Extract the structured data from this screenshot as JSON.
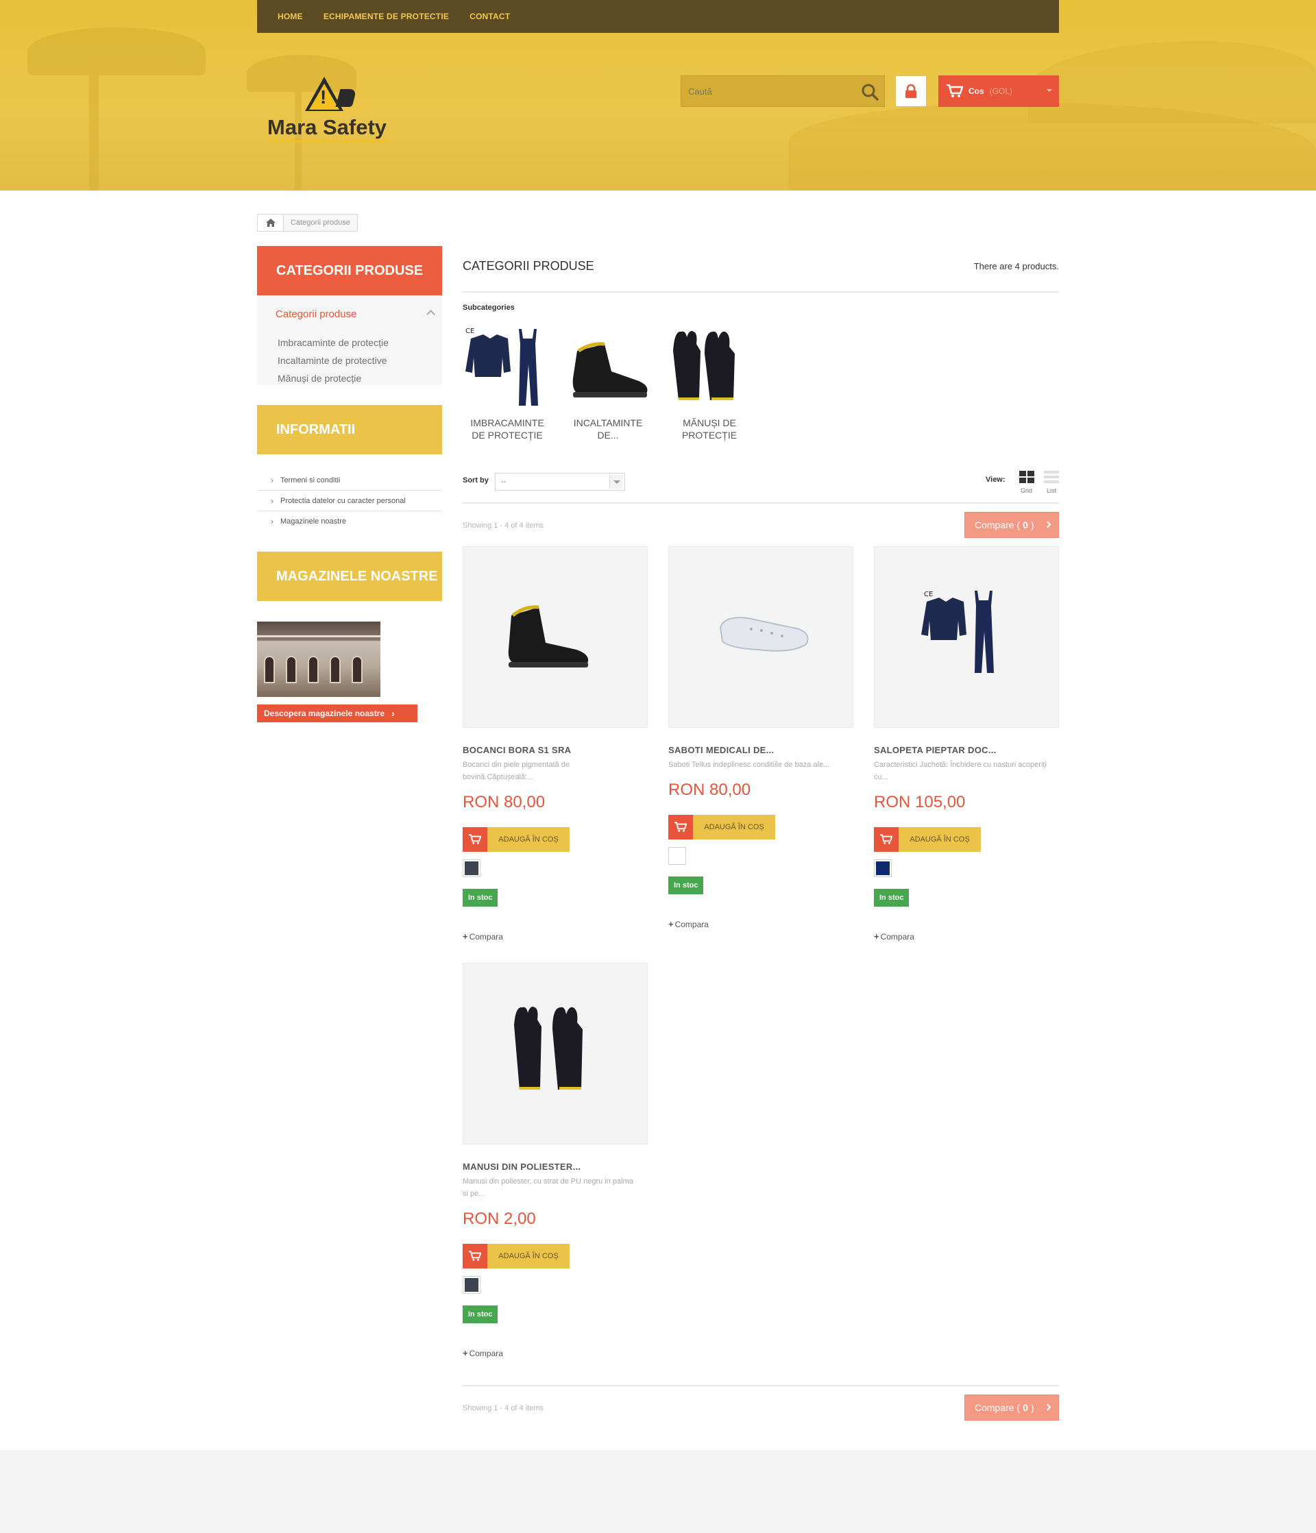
{
  "nav": {
    "items": [
      "HOME",
      "ECHIPAMENTE DE PROTECTIE",
      "CONTACT"
    ]
  },
  "logo": {
    "text": "Mara Safety"
  },
  "search": {
    "placeholder": "Caută"
  },
  "cart": {
    "label": "Cos",
    "status": "(GOL)"
  },
  "breadcrumb": {
    "current": "Categorii produse"
  },
  "sidebar": {
    "categories": {
      "title": "CATEGORII PRODUSE",
      "current": "Categorii produse",
      "items": [
        "Imbracaminte de protecție",
        "Incaltaminte de protective",
        "Mănuși de protecție"
      ]
    },
    "info": {
      "title": "INFORMATII",
      "items": [
        "Termeni si conditii",
        "Protectia datelor cu caracter personal",
        "Magazinele noastre"
      ]
    },
    "stores": {
      "title": "MAGAZINELE NOASTRE",
      "button": "Descopera magazinele noastre"
    }
  },
  "main": {
    "title": "CATEGORII PRODUSE",
    "count": "There are 4 products.",
    "subcategories_label": "Subcategories",
    "subcategories": [
      "IMBRACAMINTE DE PROTECȚIE",
      "INCALTAMINTE DE...",
      "MĂNUȘI DE PROTECȚIE"
    ],
    "sort_label": "Sort by",
    "sort_value": "--",
    "view_label": "View:",
    "view_grid": "Grid",
    "view_list": "List",
    "showing": "Showing 1 - 4 of 4 items",
    "compare_label": "Compare",
    "compare_count": "0"
  },
  "products": [
    {
      "name": "BOCANCI BORA S1 SRA",
      "desc": "Bocanci din piele pigmentată de bovină.Căptușeală:...",
      "price": "RON 80,00",
      "add": "ADAUGĂ ÎN COȘ",
      "swatch": "#3d4451",
      "stock": "In stoc",
      "compare": "Compara"
    },
    {
      "name": "SABOTI MEDICALI DE...",
      "desc": "Saboti Tellus indeplinesc conditiile de baza ale...",
      "price": "RON 80,00",
      "add": "ADAUGĂ ÎN COȘ",
      "swatch": "#ffffff",
      "stock": "In stoc",
      "compare": "Compara"
    },
    {
      "name": "SALOPETA PIEPTAR DOC...",
      "desc": "Caracteristici Jachetă: Închidere cu nasturi acoperiți cu...",
      "price": "RON 105,00",
      "add": "ADAUGĂ ÎN COȘ",
      "swatch": "#0c2a6e",
      "stock": "In stoc",
      "compare": "Compara"
    },
    {
      "name": "MANUSI DIN POLIESTER...",
      "desc": "Manusi din poliester, cu strat de PU negru in palma si pe...",
      "price": "RON 2,00",
      "add": "ADAUGĂ ÎN COȘ",
      "swatch": "#3d4451",
      "stock": "In stoc",
      "compare": "Compara"
    }
  ]
}
